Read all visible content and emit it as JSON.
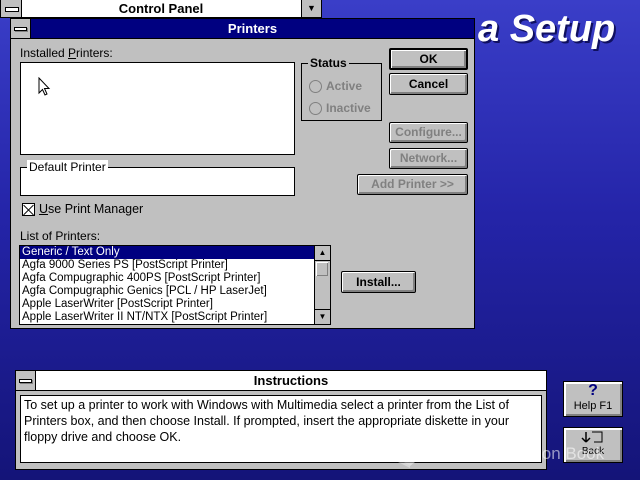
{
  "background": {
    "title": "a Setup"
  },
  "control_panel": {
    "title": "Control Panel"
  },
  "printers_window": {
    "title": "Printers",
    "installed_label_pre": "Installed ",
    "installed_label_u": "P",
    "installed_label_post": "rinters:",
    "status": {
      "legend": "Status",
      "active": "Active",
      "inactive": "Inactive"
    },
    "default_printer_label": "Default Printer",
    "use_print_manager": {
      "u": "U",
      "rest": "se Print Manager",
      "checked": true
    },
    "list_label": "List of Printers:",
    "printers": [
      "Generic / Text Only",
      "Agfa 9000 Series PS [PostScript Printer]",
      "Agfa Compugraphic 400PS [PostScript Printer]",
      "Agfa Compugraphic Genics [PCL / HP LaserJet]",
      "Apple LaserWriter [PostScript Printer]",
      "Apple LaserWriter II NT/NTX [PostScript Printer]"
    ],
    "buttons": {
      "ok": "OK",
      "cancel": "Cancel",
      "configure": "Configure...",
      "network": "Network...",
      "add_printer": "Add Printer >>",
      "install": "Install..."
    }
  },
  "instructions": {
    "title": "Instructions",
    "text": "To set up a printer to work with Windows with Multimedia select a printer from the List of Printers box, and then choose Install. If prompted, insert the appropriate diskette in your floppy drive and choose OK."
  },
  "side_buttons": {
    "help": {
      "glyph": "?",
      "label": "Help  F1"
    },
    "back": {
      "label": "Back"
    }
  },
  "watermark": "The Collection Book",
  "colors": {
    "titlebar": "#000080",
    "face": "#c0c0c0",
    "desktop": "#2424a8"
  }
}
